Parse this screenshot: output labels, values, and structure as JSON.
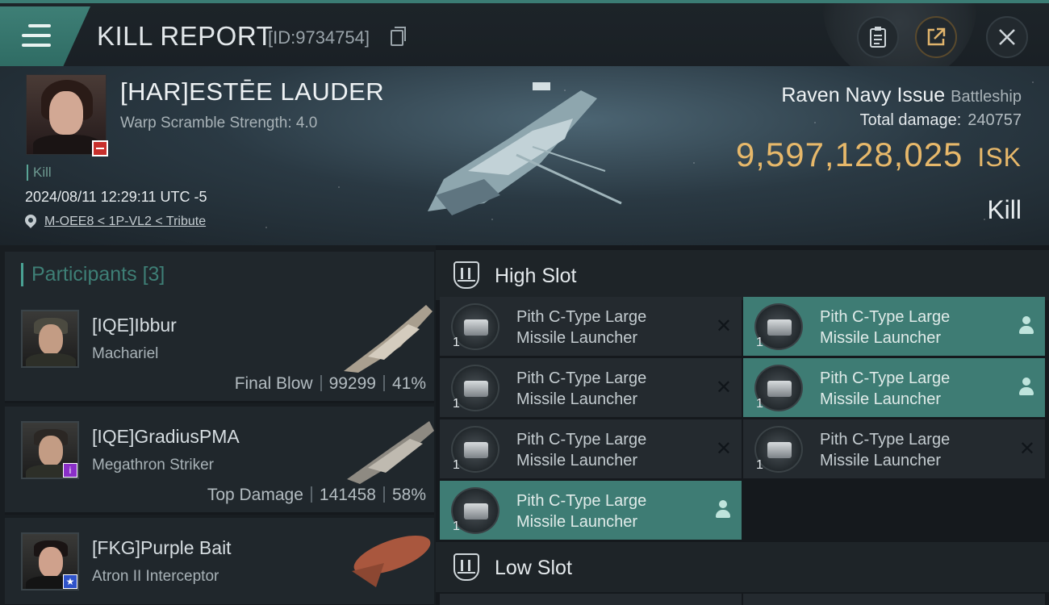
{
  "header": {
    "title": "KILL REPORT",
    "id_text": "[ID:9734754]"
  },
  "victim": {
    "name": "[HAR]ESTĒE LAUDER",
    "warp_scramble": "Warp Scramble Strength: 4.0",
    "tag": "Kill",
    "datetime": "2024/08/11 12:29:11 UTC -5",
    "location": "M-OEE8 < 1P-VL2 < Tribute",
    "ship_name": "Raven Navy Issue",
    "ship_class": "Battleship",
    "total_damage_label": "Total damage:",
    "total_damage": "240757",
    "isk_value": "9,597,128,025",
    "isk_unit": "ISK",
    "result": "Kill"
  },
  "participants": {
    "title": "Participants",
    "count": "[3]",
    "rows": [
      {
        "name": "[IQE]Ibbur",
        "ship": "Machariel",
        "label": "Final Blow",
        "damage": "99299",
        "percent": "41%"
      },
      {
        "name": "[IQE]GradiusPMA",
        "ship": "Megathron Striker",
        "label": "Top Damage",
        "damage": "141458",
        "percent": "58%"
      },
      {
        "name": "[FKG]Purple Bait",
        "ship": "Atron II Interceptor",
        "label": "",
        "damage": "",
        "percent": ""
      }
    ]
  },
  "slots": {
    "high_title": "High Slot",
    "low_title": "Low Slot",
    "modules": [
      {
        "line1": "Pith C-Type Large",
        "line2": "Missile Launcher",
        "qty": "1",
        "state": "destroyed"
      },
      {
        "line1": "Pith C-Type Large",
        "line2": "Missile Launcher",
        "qty": "1",
        "state": "dropped"
      },
      {
        "line1": "Pith C-Type Large",
        "line2": "Missile Launcher",
        "qty": "1",
        "state": "destroyed"
      },
      {
        "line1": "Pith C-Type Large",
        "line2": "Missile Launcher",
        "qty": "1",
        "state": "dropped"
      },
      {
        "line1": "Pith C-Type Large",
        "line2": "Missile Launcher",
        "qty": "1",
        "state": "destroyed"
      },
      {
        "line1": "Pith C-Type Large",
        "line2": "Missile Launcher",
        "qty": "1",
        "state": "destroyed"
      },
      {
        "line1": "Pith C-Type Large",
        "line2": "Missile Launcher",
        "qty": "1",
        "state": "dropped"
      }
    ]
  },
  "colors": {
    "accent": "#3e7c74",
    "isk": "#e7b86a",
    "victim_badge": "#c8302c"
  },
  "icons": {
    "menu": "hamburger-icon",
    "copy": "copy-icon",
    "clipboard": "clipboard-icon",
    "share": "share-icon",
    "close": "close-icon",
    "location": "location-pin-icon",
    "slot": "high-slot-icon",
    "destroyed": "x-mark-icon",
    "dropped": "person-icon"
  }
}
